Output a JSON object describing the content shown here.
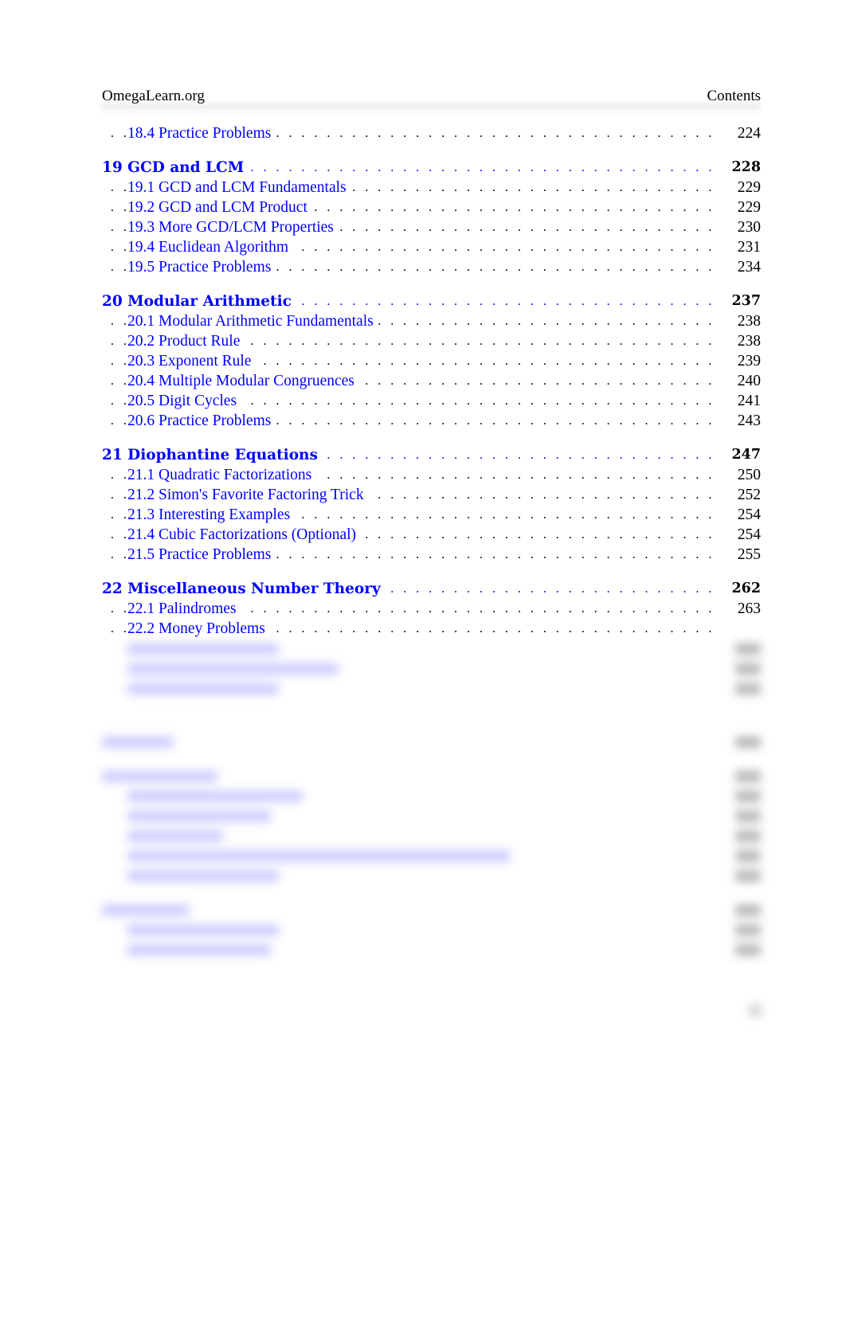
{
  "header": {
    "site": "OmegaLearn.org",
    "section": "Contents"
  },
  "toc": {
    "first_entry": {
      "title": "18.4 Practice Problems",
      "page": "224"
    },
    "chapters": [
      {
        "title": "19 GCD and LCM",
        "page": "228",
        "sections": [
          {
            "title": "19.1 GCD and LCM Fundamentals",
            "page": "229"
          },
          {
            "title": "19.2 GCD and LCM Product",
            "page": "229"
          },
          {
            "title": "19.3 More GCD/LCM Properties",
            "page": "230"
          },
          {
            "title": "19.4 Euclidean Algorithm",
            "page": "231"
          },
          {
            "title": "19.5 Practice Problems",
            "page": "234"
          }
        ]
      },
      {
        "title": "20 Modular Arithmetic",
        "page": "237",
        "sections": [
          {
            "title": "20.1 Modular Arithmetic Fundamentals",
            "page": "238"
          },
          {
            "title": "20.2 Product Rule",
            "page": "238"
          },
          {
            "title": "20.3 Exponent Rule",
            "page": "239"
          },
          {
            "title": "20.4 Multiple Modular Congruences",
            "page": "240"
          },
          {
            "title": "20.5 Digit Cycles",
            "page": "241"
          },
          {
            "title": "20.6 Practice Problems",
            "page": "243"
          }
        ]
      },
      {
        "title": "21 Diophantine Equations",
        "page": "247",
        "sections": [
          {
            "title": "21.1 Quadratic Factorizations",
            "page": "250"
          },
          {
            "title": "21.2 Simon's Favorite Factoring Trick",
            "page": "252"
          },
          {
            "title": "21.3 Interesting Examples",
            "page": "254"
          },
          {
            "title": "21.4 Cubic Factorizations (Optional)",
            "page": "254"
          },
          {
            "title": "21.5 Practice Problems",
            "page": "255"
          }
        ]
      },
      {
        "title": "22 Miscellaneous Number Theory",
        "page": "262",
        "sections": [
          {
            "title": "22.1 Palindromes",
            "page": "263"
          },
          {
            "title": "22.2 Money Problems",
            "page": ""
          }
        ]
      }
    ]
  },
  "blurred_region": {
    "note": "remaining contents are blurred and unreadable"
  }
}
